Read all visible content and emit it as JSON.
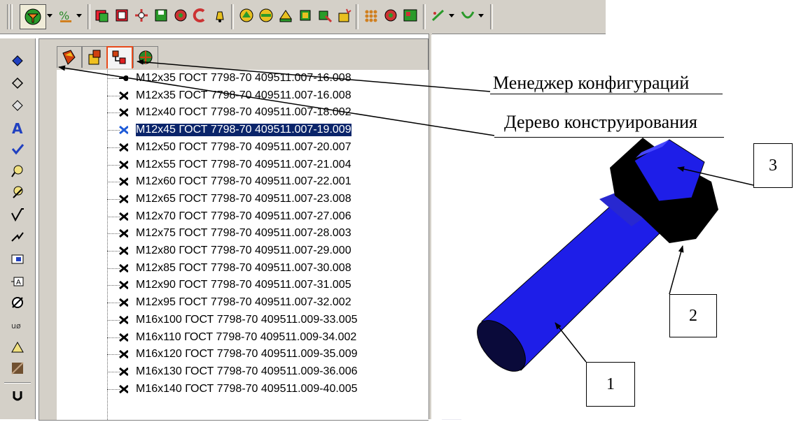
{
  "toolbar": {
    "buttons": [
      "filter-icon",
      "equation-icon",
      "new-part-icon",
      "open-part-icon",
      "mate-icon",
      "save-icon",
      "pan-icon",
      "rotate-icon",
      "bell-icon",
      "sphere-icon",
      "sphere2-icon",
      "extrude-icon",
      "cube-icon",
      "cube2-icon",
      "explode-icon",
      "pattern-icon",
      "gear-icon",
      "table-icon",
      "sketch-icon",
      "curve-icon"
    ]
  },
  "feature_manager": {
    "tabs": [
      "feature-tree-tab",
      "property-tab",
      "configuration-tab",
      "display-tab"
    ],
    "active_tab": 2,
    "tree_rows": [
      "M12x35 ГОСТ 7798-70  409511.007-16.008",
      "M12x35 ГОСТ 7798-70  409511.007-16.008",
      "M12x40 ГОСТ 7798-70  409511.007-18.002",
      "M12x45 ГОСТ 7798-70  409511.007-19.009",
      "M12x50 ГОСТ 7798-70  409511.007-20.007",
      "M12x55 ГОСТ 7798-70  409511.007-21.004",
      "M12x60 ГОСТ 7798-70  409511.007-22.001",
      "M12x65 ГОСТ 7798-70  409511.007-23.008",
      "M12x70 ГОСТ 7798-70  409511.007-27.006",
      "M12x75 ГОСТ 7798-70  409511.007-28.003",
      "M12x80 ГОСТ 7798-70  409511.007-29.000",
      "M12x85 ГОСТ 7798-70  409511.007-30.008",
      "M12x90 ГОСТ 7798-70  409511.007-31.005",
      "M12x95 ГОСТ 7798-70  409511.007-32.002",
      "M16x100 ГОСТ 7798-70  409511.009-33.005",
      "M16x110 ГОСТ 7798-70  409511.009-34.002",
      "M16x120 ГОСТ 7798-70  409511.009-35.009",
      "M16x130 ГОСТ 7798-70  409511.009-36.006",
      "M16x140 ГОСТ 7798-70  409511.009-40.005"
    ],
    "selected_index": 3
  },
  "left_toolbar": {
    "icons": [
      "smart-dimension-icon",
      "dimension-icon",
      "datum-icon",
      "text-annotation-icon",
      "spell-check-icon",
      "balloon-icon",
      "auto-balloon-icon",
      "surface-finish-icon",
      "weld-symbol-icon",
      "datum-feature-icon",
      "datum-target-icon",
      "hole-callout-icon",
      "cosmetic-thread-icon",
      "geometric-tolerance-icon",
      "hatch-icon",
      "block-icon"
    ]
  },
  "callouts": {
    "config_manager": "Менеджер конфигураций",
    "design_tree": "Дерево конструирования"
  },
  "labels": {
    "one": "1",
    "two": "2",
    "three": "3"
  },
  "colors": {
    "bolt": "#1e1ee8",
    "selection": "#0a246a",
    "active_tab_border": "#e84a1a"
  }
}
